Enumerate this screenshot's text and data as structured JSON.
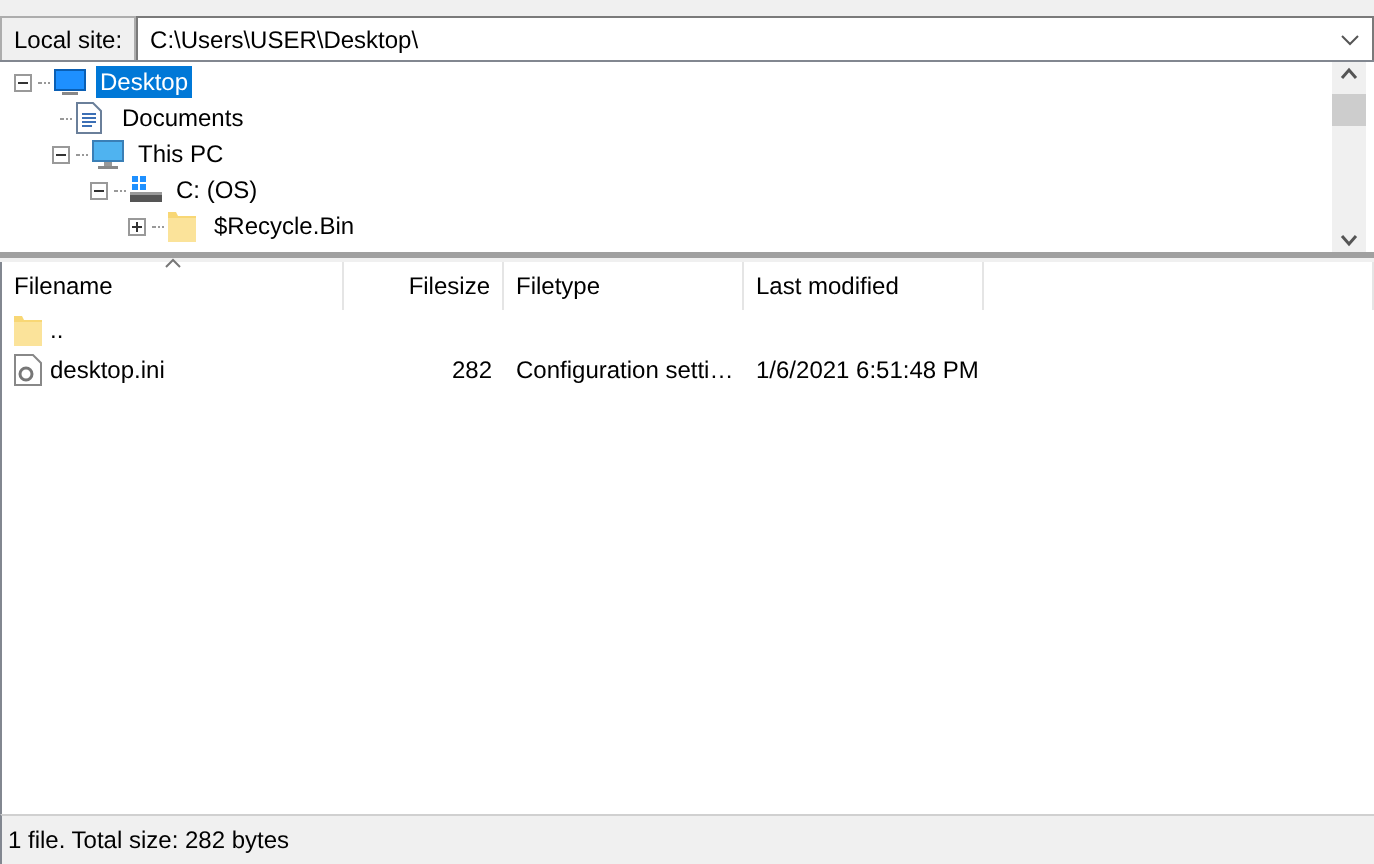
{
  "local_site": {
    "label": "Local site:",
    "value": "C:\\Users\\USER\\Desktop\\"
  },
  "tree": [
    {
      "label": "Desktop",
      "kind": "desktop",
      "expanded": true,
      "selected": true,
      "children": [
        {
          "label": "Documents",
          "kind": "document",
          "selected": false
        },
        {
          "label": "This PC",
          "kind": "pc",
          "expanded": true,
          "selected": false,
          "children": [
            {
              "label": "C: (OS)",
              "kind": "drive",
              "expanded": true,
              "selected": false,
              "children": [
                {
                  "label": "$Recycle.Bin",
                  "kind": "folder",
                  "expanded": false,
                  "selected": false
                }
              ]
            }
          ]
        }
      ]
    }
  ],
  "table": {
    "columns": [
      {
        "label": "Filename",
        "sorted": true
      },
      {
        "label": "Filesize",
        "sorted": false
      },
      {
        "label": "Filetype",
        "sorted": false
      },
      {
        "label": "Last modified",
        "sorted": false
      }
    ],
    "rows": [
      {
        "kind": "folder",
        "cells": [
          "..",
          "",
          "",
          ""
        ]
      },
      {
        "kind": "file",
        "cells": [
          "desktop.ini",
          "282",
          "Configuration setti…",
          "1/6/2021 6:51:48 PM"
        ]
      }
    ]
  },
  "status_bar": "1 file. Total size: 282 bytes"
}
